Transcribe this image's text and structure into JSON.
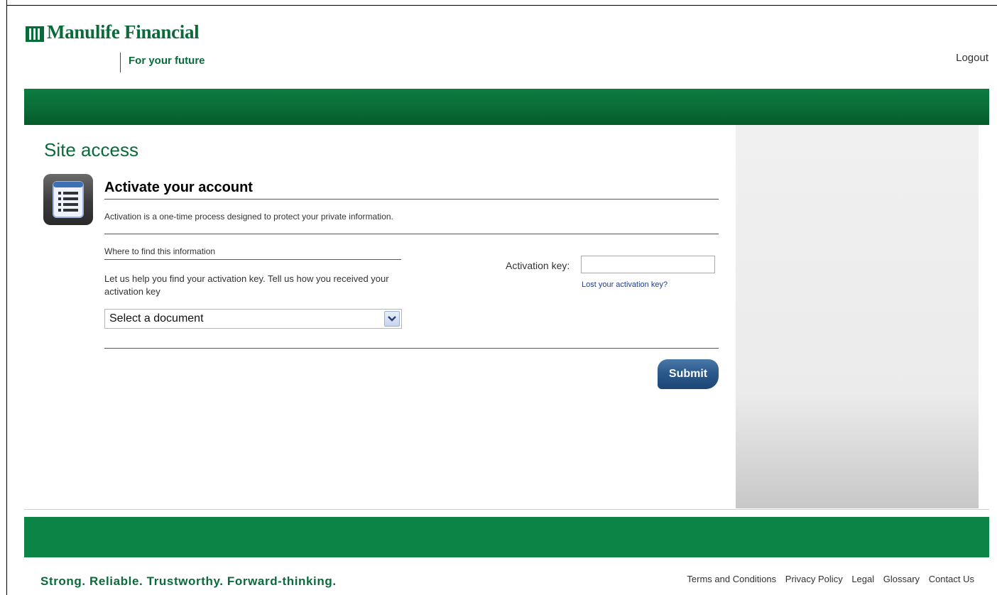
{
  "header": {
    "brand_name": "Manulife Financial",
    "tagline": "For your future",
    "logout_label": "Logout"
  },
  "main": {
    "page_title": "Site access",
    "section_heading": "Activate your account",
    "section_description": "Activation is a one-time process designed to protect your private information.",
    "where_title": "Where to find this information",
    "help_text": "Let us help you find your activation key. Tell us how you received your activation key",
    "document_select": {
      "selected": "Select a document"
    },
    "activation_key_label": "Activation key:",
    "activation_key_value": "",
    "lost_key_link": "Lost your activation key?",
    "submit_label": "Submit"
  },
  "footer": {
    "tagline": "Strong. Reliable. Trustworthy. Forward-thinking.",
    "links": [
      "Terms and Conditions",
      "Privacy Policy",
      "Legal",
      "Glossary",
      "Contact Us"
    ]
  },
  "icons": {
    "logo": "manulife-logo-mark",
    "section": "document-list-icon",
    "dropdown": "chevron-down-icon"
  },
  "colors": {
    "brand_green": "#0a6b3a",
    "bar_green": "#0b8445",
    "button_blue": "#2b5a8d",
    "link_blue": "#1d3f8f"
  }
}
